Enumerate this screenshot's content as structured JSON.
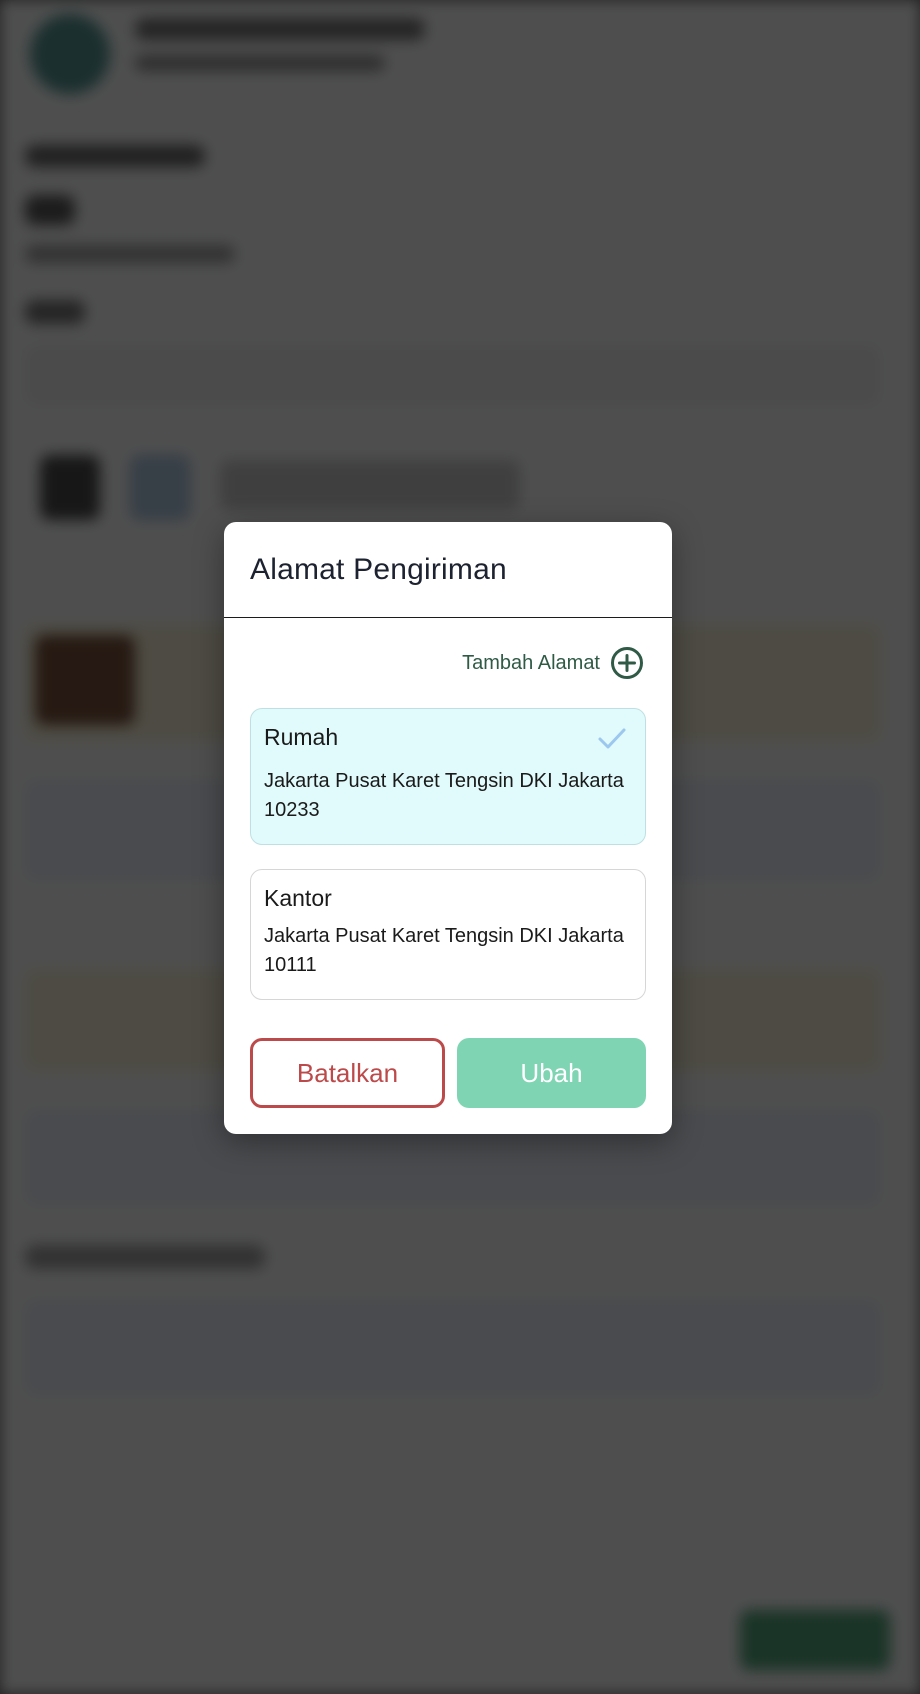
{
  "modal": {
    "title": "Alamat Pengiriman",
    "add_address_label": "Tambah Alamat",
    "add_icon": "plus-circle-icon",
    "check_icon": "checkmark-icon",
    "addresses": [
      {
        "name": "Rumah",
        "detail": "Jakarta Pusat Karet Tengsin DKI Jakarta 10233",
        "selected": true
      },
      {
        "name": "Kantor",
        "detail": "Jakarta Pusat Karet Tengsin DKI Jakarta 10111",
        "selected": false
      }
    ],
    "cancel_label": "Batalkan",
    "submit_label": "Ubah"
  },
  "colors": {
    "accent_green": "#2f5b46",
    "selected_card_bg": "#e1fafb",
    "cancel_red": "#bd4a4a",
    "submit_green": "#7fd5b3",
    "check_blue": "#9cc7ef"
  }
}
